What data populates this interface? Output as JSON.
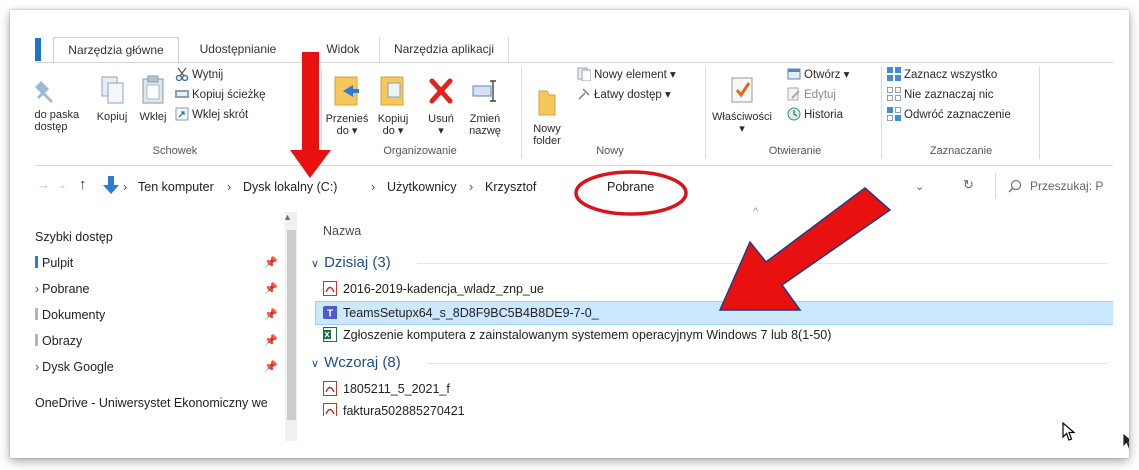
{
  "ribbon": {
    "tabs": [
      "Narzędzia główne",
      "Udostępnianie",
      "Widok",
      "Narzędzia aplikacji"
    ],
    "pin_label_1": "j do paska",
    "pin_label_2": "i dostęp",
    "copy": "Kopiuj",
    "paste": "Wklej",
    "cut": "Wytnij",
    "copy_path": "Kopiuj ścieżkę",
    "paste_shortcut": "Wklej skrót",
    "group_clipboard": "Schowek",
    "move_to_1": "Przenieś",
    "move_to_2": "do ▾",
    "copy_to_1": "Kopiuj",
    "copy_to_2": "do ▾",
    "delete_1": "Usuń",
    "delete_2": "▾",
    "rename_1": "Zmień",
    "rename_2": "nazwę",
    "group_organize": "Organizowanie",
    "new_folder_1": "Nowy",
    "new_folder_2": "folder",
    "new_item": "Nowy element ▾",
    "easy_access": "Łatwy dostęp ▾",
    "group_new": "Nowy",
    "properties_1": "Właściwości",
    "properties_2": "▾",
    "open": "Otwórz ▾",
    "edit": "Edytuj",
    "history": "Historia",
    "group_open": "Otwieranie",
    "select_all": "Zaznacz wszystko",
    "select_none": "Nie zaznaczaj nic",
    "invert_selection": "Odwróć zaznaczenie",
    "group_select": "Zaznaczanie"
  },
  "address": {
    "crumbs": [
      "Ten komputer",
      "Dysk lokalny (C:)",
      "Użytkownicy",
      "Krzysztof",
      "Pobrane"
    ],
    "search_placeholder": "Przeszukaj: P"
  },
  "nav": {
    "quick_access": "Szybki dostęp",
    "items": [
      "Pulpit",
      "Pobrane",
      "Dokumenty",
      "Obrazy",
      "Dysk Google"
    ],
    "onedrive": "OneDrive - Uniwersystet Ekonomiczny we"
  },
  "content": {
    "column_name": "Nazwa",
    "group_today": "Dzisiaj (3)",
    "group_yesterday": "Wczoraj (8)",
    "files_today": [
      "2016-2019-kadencja_wladz_znp_ue",
      "TeamsSetupx64_s_8D8F9BC5B4B8DE9-7-0_",
      "Zgłoszenie komputera z zainstalowanym systemem operacyjnym Windows 7 lub 8(1-50)"
    ],
    "files_yesterday": [
      "1805211_5_2021_f",
      "faktura502885270421"
    ]
  },
  "colors": {
    "annotation_red": "#e8110f",
    "selection_bg": "#cce8ff",
    "group_header": "#1e4e8c",
    "accent_blue": "#1a73d0"
  }
}
